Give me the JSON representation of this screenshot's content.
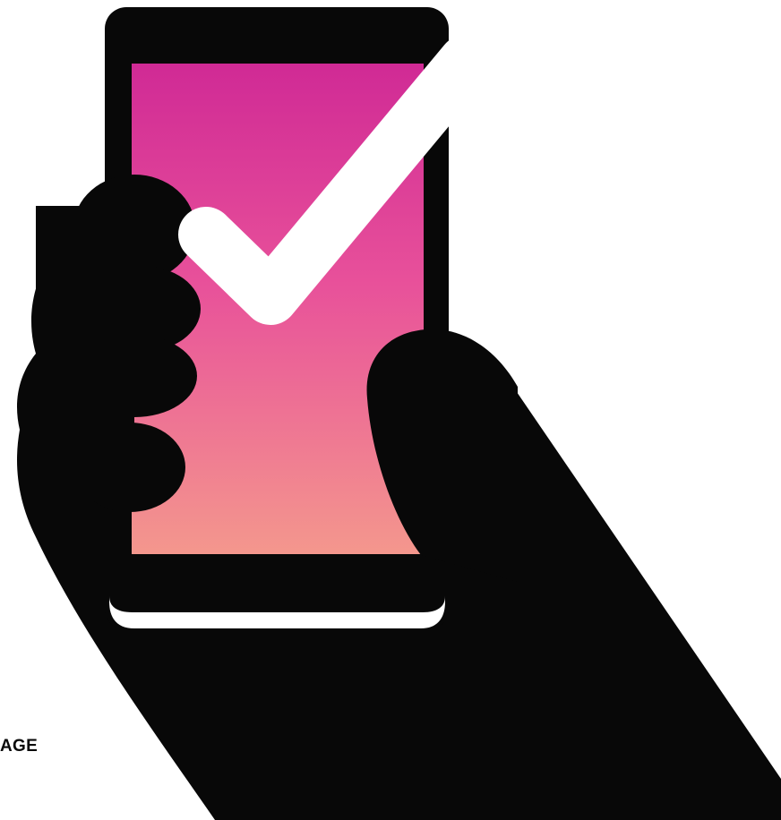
{
  "illustration": {
    "icon": "hand-holding-phone-checkmark-icon",
    "colors": {
      "silhouette": "#080808",
      "screen_top": "#d02a95",
      "screen_bottom": "#f4978d",
      "checkmark": "#ffffff",
      "background": "#ffffff"
    }
  },
  "footer": {
    "label": "AGE"
  }
}
